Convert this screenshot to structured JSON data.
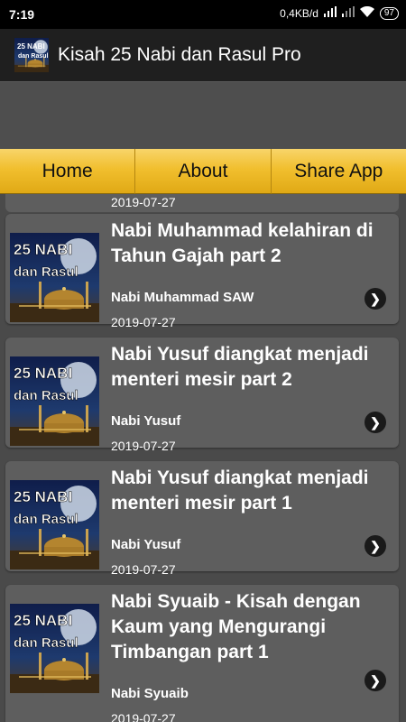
{
  "status_bar": {
    "time": "7:19",
    "net_speed": "0,4KB/d",
    "battery": "97"
  },
  "app": {
    "title": "Kisah 25 Nabi dan Rasul Pro"
  },
  "tabs": [
    {
      "label": "Home"
    },
    {
      "label": "About"
    },
    {
      "label": "Share App"
    }
  ],
  "partial_item": {
    "date": "2019-07-27"
  },
  "items": [
    {
      "title": "Nabi Muhammad kelahiran di Tahun Gajah part 2",
      "category": "Nabi Muhammad SAW",
      "date": "2019-07-27"
    },
    {
      "title": "Nabi Yusuf diangkat menjadi menteri mesir part 2",
      "category": "Nabi Yusuf",
      "date": "2019-07-27"
    },
    {
      "title": "Nabi Yusuf diangkat menjadi menteri mesir part 1",
      "category": "Nabi Yusuf",
      "date": "2019-07-27"
    },
    {
      "title": "Nabi Syuaib - Kisah dengan Kaum yang Mengurangi Timbangan part 1",
      "category": "Nabi Syuaib",
      "date": "2019-07-27"
    }
  ],
  "thumb_text": {
    "line1": "25 NABI",
    "line2": "dan Rasul"
  }
}
